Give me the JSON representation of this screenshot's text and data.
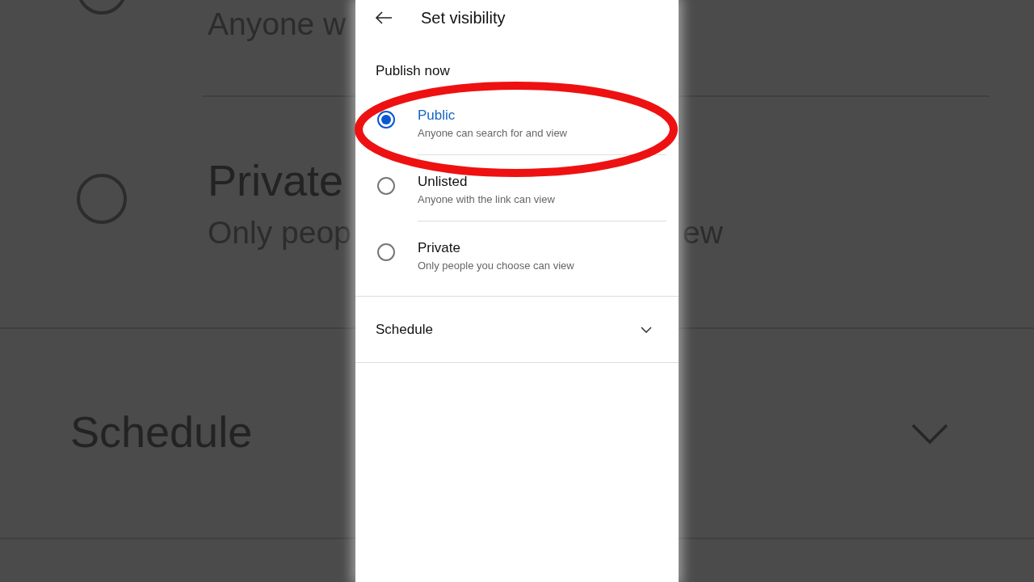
{
  "background": {
    "radios": [
      {
        "selected": false
      },
      {
        "selected": false
      }
    ],
    "texts": [
      {
        "kind": "subtitle",
        "text": "Anyone w"
      },
      {
        "kind": "title",
        "text": "Private"
      },
      {
        "kind": "subtitle",
        "text": "Only peop"
      },
      {
        "kind": "subtitle",
        "text": "ew"
      },
      {
        "kind": "title",
        "text": "Schedule"
      }
    ]
  },
  "screen": {
    "title": "Set visibility",
    "section": "Publish now",
    "options": [
      {
        "title": "Public",
        "subtitle": "Anyone can search for and view",
        "selected": true
      },
      {
        "title": "Unlisted",
        "subtitle": "Anyone with the link can view",
        "selected": false
      },
      {
        "title": "Private",
        "subtitle": "Only people you choose can view",
        "selected": false
      }
    ],
    "schedule": {
      "label": "Schedule",
      "expanded": false
    }
  }
}
